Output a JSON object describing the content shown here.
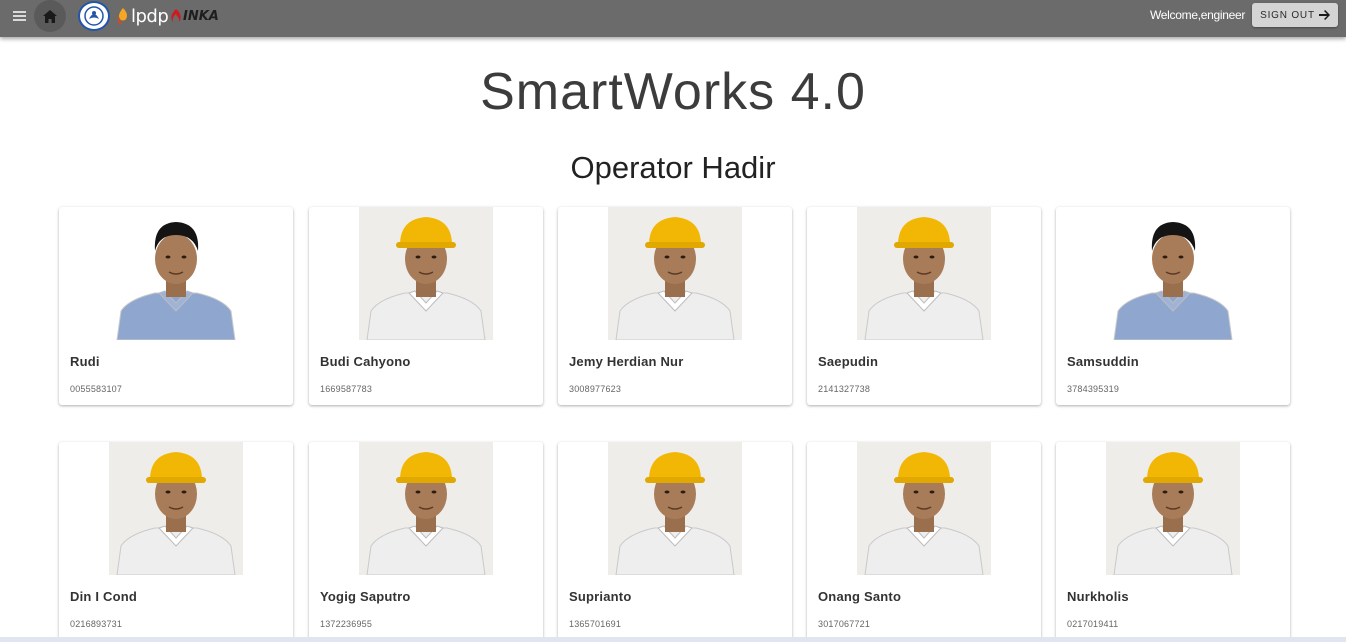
{
  "header": {
    "welcome_text": "Welcome,engineer",
    "signout_label": "SIGN OUT",
    "logos": [
      "lpdp",
      "INKA"
    ]
  },
  "main": {
    "title": "SmartWorks 4.0",
    "section_title": "Operator Hadir"
  },
  "operators": [
    {
      "name": "Rudi",
      "id": "0055583107",
      "hard_hat": false,
      "shirt": "blue"
    },
    {
      "name": "Budi Cahyono",
      "id": "1669587783",
      "hard_hat": true,
      "shirt": "white"
    },
    {
      "name": "Jemy Herdian Nur",
      "id": "3008977623",
      "hard_hat": true,
      "shirt": "white"
    },
    {
      "name": "Saepudin",
      "id": "2141327738",
      "hard_hat": true,
      "shirt": "white"
    },
    {
      "name": "Samsuddin",
      "id": "3784395319",
      "hard_hat": false,
      "shirt": "blue"
    },
    {
      "name": "Din I Cond",
      "id": "0216893731",
      "hard_hat": true,
      "shirt": "white"
    },
    {
      "name": "Yogig Saputro",
      "id": "1372236955",
      "hard_hat": true,
      "shirt": "white"
    },
    {
      "name": "Suprianto",
      "id": "1365701691",
      "hard_hat": true,
      "shirt": "white"
    },
    {
      "name": "Onang Santo",
      "id": "3017067721",
      "hard_hat": true,
      "shirt": "white"
    },
    {
      "name": "Nurkholis",
      "id": "0217019411",
      "hard_hat": true,
      "shirt": "white"
    }
  ],
  "colors": {
    "topbar": "#6b6b6b",
    "hard_hat": "#f2b705",
    "work_shirt": "#eeeeee",
    "blue_shirt": "#8fa6cf",
    "photo_bg": "#efedea"
  }
}
